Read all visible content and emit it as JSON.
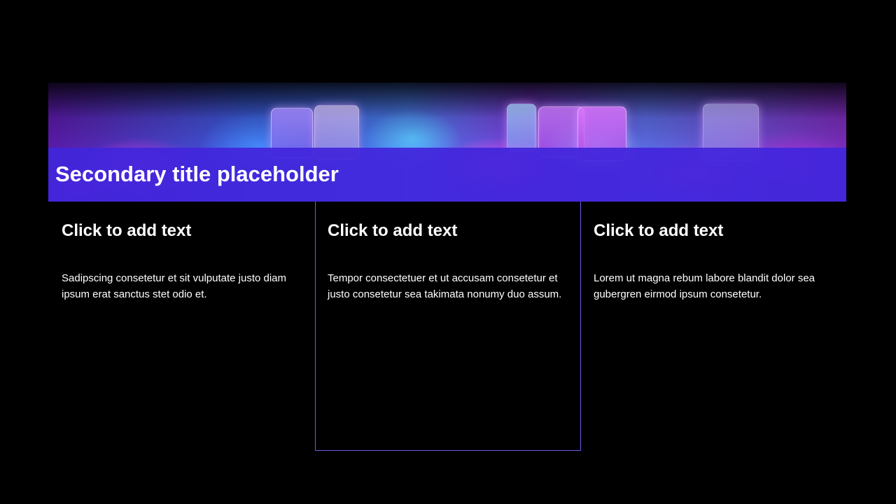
{
  "slide": {
    "title": "Secondary title placeholder",
    "columns": [
      {
        "heading": "Click to add text",
        "body": "Sadipscing consetetur et sit vulputate justo diam ipsum erat sanctus stet odio et."
      },
      {
        "heading": "Click to add text",
        "body": "Tempor consectetuer et ut accusam consetetur et justo consetetur sea takimata nonumy duo assum."
      },
      {
        "heading": "Click to add text",
        "body": "Lorem ut magna rebum labore blandit dolor sea gubergren eirmod ipsum consetetur."
      }
    ]
  },
  "colors": {
    "background": "#000000",
    "title_bar": "#4226dc",
    "highlight_border": "#6c5ce8",
    "text": "#ffffff"
  }
}
